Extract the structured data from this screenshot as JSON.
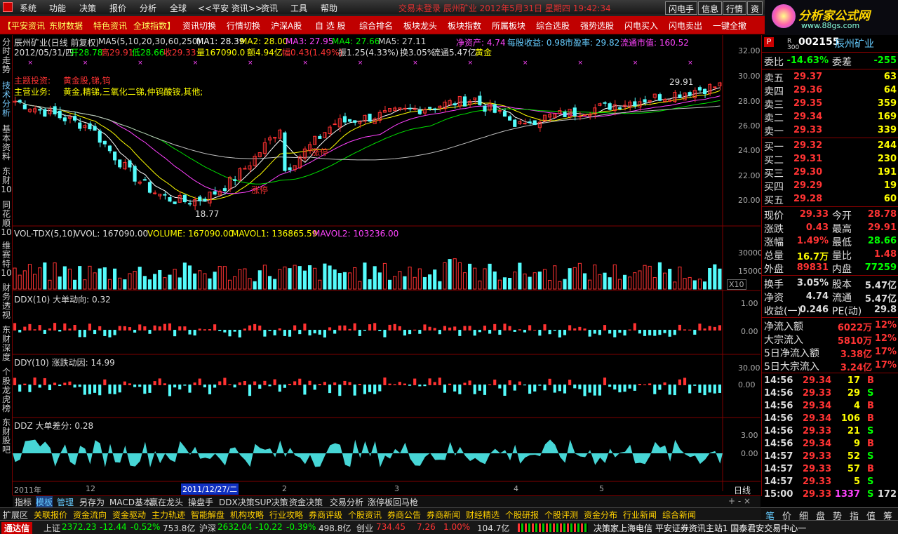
{
  "menu": {
    "items": [
      "系统",
      "功能",
      "决策",
      "报价",
      "分析",
      "全球",
      "<<平安 资讯>>",
      "资讯",
      "工具",
      "帮助"
    ],
    "status": "交易未登录   辰州矿业  2012年5月31日 星期四 19:42:34",
    "buttons": [
      "闪电手",
      "信息",
      "行情",
      "资"
    ]
  },
  "logo": {
    "site": "分析家公式网",
    "url": "www.88gs.com"
  },
  "quickbar": [
    "【平安资讯",
    "东财数据",
    "特色资讯",
    "全球指数】",
    "资讯切换",
    "行情切换",
    "沪深A股",
    "自 选 股",
    "综合排名",
    "板块龙头",
    "板块指数",
    "所属板块",
    "综合选股",
    "强势选股",
    "闪电买入",
    "闪电卖出",
    "一键全撤"
  ],
  "lefttabs": [
    "分时走势",
    "技术分析",
    "基本资料",
    "东财10",
    "同花顺10",
    "维赛特10",
    "财务透视",
    "东财深度",
    "个股龙虎榜",
    "东财股吧"
  ],
  "chart": {
    "header": {
      "title": "辰州矿业(日线 前复权)",
      "ma5": "MA5(5,10,20,30,60,250)",
      "ma1": "MA1: 28.39",
      "ma2": "MA2: 28.00",
      "ma3": "MA3: 27.95",
      "ma4": "MA4: 27.66",
      "ma5v": "MA5: 27.11",
      "jzc": "净资产: 4.74",
      "mgsy": "每股收益: 0.98",
      "syl": "市盈率: 29.82",
      "ltsz": "流通市值: 160.52"
    },
    "info": {
      "date": "2012/05/31/四",
      "open": "开28.78",
      "high": "高29.91",
      "low": "低28.66",
      "close": "收29.33",
      "vol": "量167090.0",
      "amt": "额4.94亿",
      "fu": "幅0.43(1.49%)",
      "zhen": "振1.25(4.33%)",
      "huan": "换3.05%",
      "lt": "流通5.47亿",
      "gold": "黄金"
    },
    "theme_label": "主题投资:",
    "theme": "黄金股,锑,钨",
    "biz_label": "主营业务:",
    "biz": "黄金,精锑,三氧化二锑,仲钨酸铵,其他;",
    "hi_label": "29.91",
    "lo_label": "18.77",
    "zt1": "涨停",
    "zt2": "涨停",
    "yaxis": [
      "32.00",
      "30.00",
      "28.00",
      "26.00",
      "24.00",
      "22.00",
      "20.00"
    ],
    "vol_header": {
      "name": "VOL-TDX(5,10)",
      "vvol": "VVOL: 167090.00",
      "volume": "VOLUME: 167090.00",
      "mavol1": "MAVOL1: 136865.59",
      "mavol2": "MAVOL2: 103236.00"
    },
    "vol_axis": [
      "30000",
      "15000"
    ],
    "vol_unit": "X10",
    "ddx_header": "DDX(10) 大单动向: 0.32",
    "ddx_axis": [
      "1.00",
      "0.00"
    ],
    "ddy_header": "DDY(10) 涨跌动因: 14.99",
    "ddy_axis": [
      "30.00",
      "0.00"
    ],
    "ddz_header": "DDZ 大单差分: 0.28",
    "ddz_axis": [
      "3.00",
      "0.00"
    ],
    "xaxis": {
      "y2011": "2011年",
      "m12": "12",
      "cursor": "2011/12/27/二",
      "m2": "2",
      "m3": "3",
      "m4": "4",
      "m5": "5",
      "period": "日线"
    },
    "colors": {
      "up": "#ff3232",
      "down": "#54fcfc",
      "ma1": "#ffffff",
      "ma2": "#ffff00",
      "ma3": "#ff40ff",
      "ma4": "#00e000",
      "ma5": "#c0c0c0",
      "ma6": "#a0a0a0"
    }
  },
  "bottomtabs": [
    "指标",
    "模板",
    "管理",
    "另存为",
    "MACD基本",
    "赢在龙头",
    "操盘手",
    "DDX决策",
    "SUP决策",
    "资金决策",
    "交易分析",
    "涨停板回马枪"
  ],
  "linkbar": [
    "扩展区",
    "关联报价",
    "资金流向",
    "资金驱动",
    "主力轨迹",
    "智能解盘",
    "机构攻略",
    "行业攻略",
    "券商评级",
    "个股资讯",
    "券商公告",
    "券商新闻",
    "财经精选",
    "个股研报",
    "个股评测",
    "资金分布",
    "行业新闻",
    "综合新闻"
  ],
  "quote": {
    "code": "002155",
    "name": "辰州矿业",
    "ribbon": "R 300",
    "p": "P",
    "weibi": "-14.63%",
    "weicha": "-255",
    "asks": [
      [
        "卖五",
        "29.37",
        "63"
      ],
      [
        "卖四",
        "29.36",
        "64"
      ],
      [
        "卖三",
        "29.35",
        "359"
      ],
      [
        "卖二",
        "29.34",
        "169"
      ],
      [
        "卖一",
        "29.33",
        "339"
      ]
    ],
    "bids": [
      [
        "买一",
        "29.32",
        "244"
      ],
      [
        "买二",
        "29.31",
        "230"
      ],
      [
        "买三",
        "29.30",
        "191"
      ],
      [
        "买四",
        "29.29",
        "19"
      ],
      [
        "买五",
        "29.28",
        "60"
      ]
    ],
    "stats": [
      [
        "现价",
        "29.33",
        "今开",
        "28.78"
      ],
      [
        "涨跌",
        "0.43",
        "最高",
        "29.91"
      ],
      [
        "涨幅",
        "1.49%",
        "最低",
        "28.66"
      ],
      [
        "总量",
        "16.7万",
        "量比",
        "1.48"
      ],
      [
        "外盘",
        "89831",
        "内盘",
        "77259"
      ]
    ],
    "stats2": [
      [
        "换手",
        "3.05%",
        "股本",
        "5.47亿"
      ],
      [
        "净资",
        "4.74",
        "流通",
        "5.47亿"
      ],
      [
        "收益(一)",
        "0.246",
        "PE(动)",
        "29.8"
      ]
    ],
    "flows": [
      [
        "净流入额",
        "6022万",
        "12%"
      ],
      [
        "大宗流入",
        "5810万",
        "12%"
      ],
      [
        "5日净流入额",
        "3.38亿",
        "17%"
      ],
      [
        "5日大宗流入",
        "3.24亿",
        "17%"
      ]
    ],
    "ticks": [
      [
        "14:56",
        "29.34",
        "17",
        "B"
      ],
      [
        "14:56",
        "29.33",
        "29",
        "S"
      ],
      [
        "14:56",
        "29.34",
        "4",
        "B"
      ],
      [
        "14:56",
        "29.34",
        "106",
        "B"
      ],
      [
        "14:56",
        "29.33",
        "21",
        "S"
      ],
      [
        "14:56",
        "29.34",
        "9",
        "B"
      ],
      [
        "14:57",
        "29.33",
        "52",
        "S"
      ],
      [
        "14:57",
        "29.33",
        "57",
        "B"
      ],
      [
        "14:57",
        "29.33",
        "5",
        "S"
      ],
      [
        "15:00",
        "29.33",
        "1337",
        "S"
      ]
    ],
    "last_extra": "172",
    "weibi_l": "委比",
    "weicha_l": "委差",
    "tabs": [
      "笔",
      "价",
      "细",
      "盘",
      "势",
      "指",
      "值",
      "筹"
    ]
  },
  "status": {
    "app": "通达信",
    "sh_label": "上证",
    "sh": "2372.23",
    "sh_chg": "-12.44",
    "sh_pct": "-0.52%",
    "sh_amt": "753.8亿",
    "hs_label": "沪深",
    "hs": "2632.04",
    "hs_chg": "-10.22",
    "hs_pct": "-0.39%",
    "hs_amt": "498.8亿",
    "cy_label": "创业",
    "cy": "734.45",
    "cy_chg": "7.26",
    "cy_pct": "1.00%",
    "cy_amt": "104.7亿",
    "msg": "决策家上海电信  平安证券资讯主站1  国泰君安交易中心一"
  }
}
